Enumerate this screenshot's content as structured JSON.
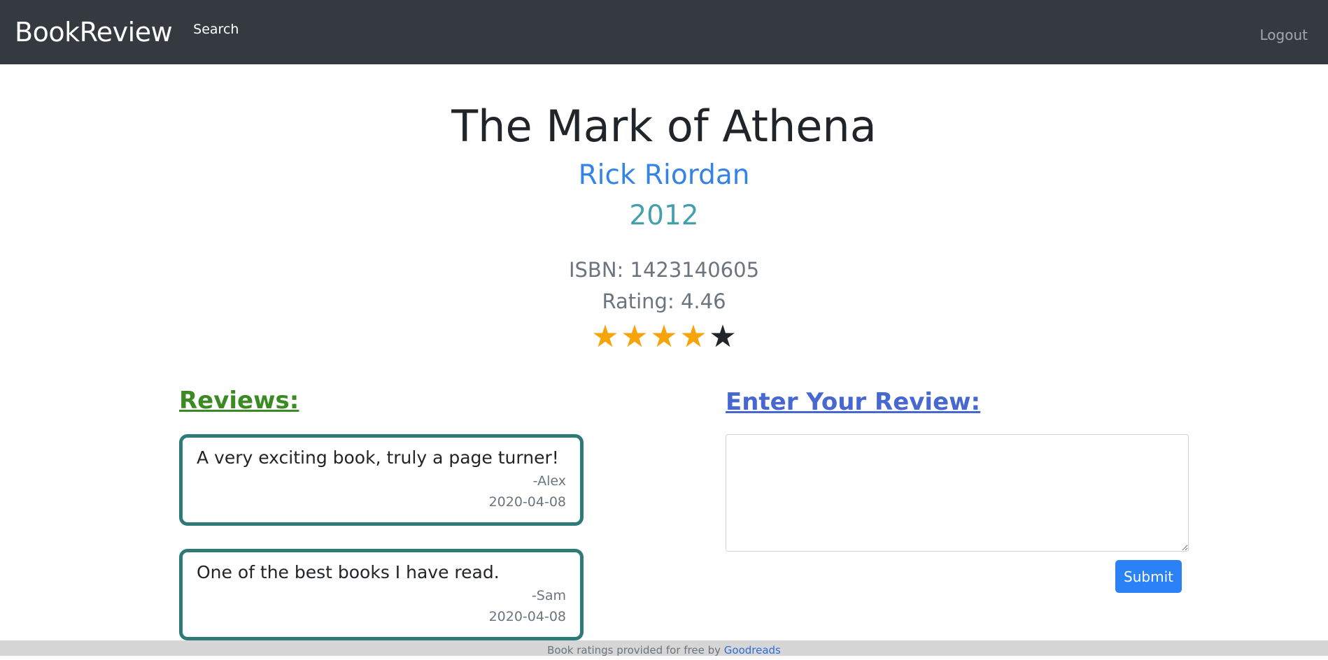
{
  "nav": {
    "brand": "BookReview",
    "search_label": "Search",
    "logout_label": "Logout"
  },
  "book": {
    "title": "The Mark of Athena",
    "author": "Rick Riordan",
    "year": "2012",
    "isbn_text": "ISBN: 1423140605",
    "rating_text": "Rating: 4.46",
    "rating_value": 4.46,
    "stars_filled": 4,
    "stars_total": 5
  },
  "reviews": {
    "heading": "Reviews:",
    "items": [
      {
        "text": "A very exciting book, truly a page turner!",
        "author": "-Alex",
        "date": "2020-04-08"
      },
      {
        "text": "One of the best books I have read.",
        "author": "-Sam",
        "date": "2020-04-08"
      }
    ]
  },
  "review_form": {
    "heading": "Enter Your Review:",
    "placeholder": "",
    "value": "",
    "submit_label": "Submit"
  },
  "footer": {
    "text": "Book ratings provided for free by ",
    "link_label": "Goodreads"
  },
  "colors": {
    "navbar": "#343a40",
    "author": "#3483e6",
    "year": "#45a0ad",
    "reviews_heading": "#3c8a24",
    "enter_heading": "#4868d1",
    "card_border": "#2d7a77",
    "star_on": "#f5a50a",
    "star_off": "#212529",
    "submit": "#2b82f6"
  }
}
